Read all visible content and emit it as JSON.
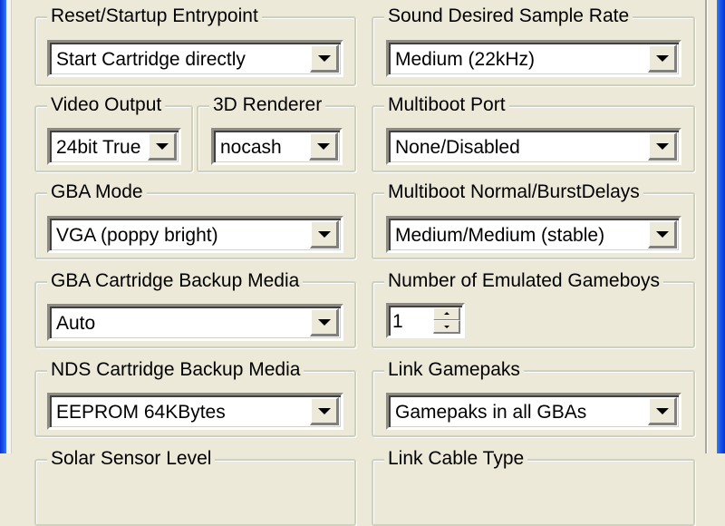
{
  "dialog": {
    "groups": {
      "reset_startup": {
        "label": "Reset/Startup Entrypoint",
        "value": "Start Cartridge directly"
      },
      "sound_rate": {
        "label": "Sound Desired Sample Rate",
        "value": "Medium (22kHz)"
      },
      "video_output": {
        "label": "Video Output",
        "value": "24bit True"
      },
      "renderer_3d": {
        "label": "3D Renderer",
        "value": "nocash"
      },
      "multiboot_port": {
        "label": "Multiboot Port",
        "value": "None/Disabled"
      },
      "gba_mode": {
        "label": "GBA Mode",
        "value": "VGA (poppy bright)"
      },
      "multiboot_delays": {
        "label": "Multiboot Normal/BurstDelays",
        "value": "Medium/Medium (stable)"
      },
      "gba_backup": {
        "label": "GBA Cartridge Backup Media",
        "value": "Auto"
      },
      "num_gameboys": {
        "label": "Number of Emulated Gameboys",
        "value": "1"
      },
      "nds_backup": {
        "label": "NDS Cartridge Backup Media",
        "value": "EEPROM 64KBytes"
      },
      "link_gamepaks": {
        "label": "Link Gamepaks",
        "value": "Gamepaks in all GBAs"
      },
      "solar_sensor": {
        "label": "Solar Sensor Level"
      },
      "link_cable": {
        "label": "Link Cable Type"
      }
    }
  }
}
